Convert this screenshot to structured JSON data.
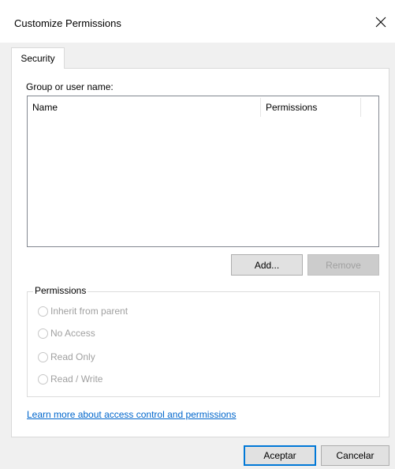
{
  "window": {
    "title": "Customize Permissions"
  },
  "tabs": [
    {
      "label": "Security",
      "selected": true
    }
  ],
  "security": {
    "group_label": "Group or user name:",
    "columns": [
      "Name",
      "Permissions"
    ],
    "rows": [],
    "add_label": "Add...",
    "remove_label": "Remove",
    "remove_enabled": false,
    "permissions_legend": "Permissions",
    "permission_options": [
      {
        "label": "Inherit from parent",
        "selected": false,
        "enabled": false
      },
      {
        "label": "No Access",
        "selected": false,
        "enabled": false
      },
      {
        "label": "Read Only",
        "selected": false,
        "enabled": false
      },
      {
        "label": "Read / Write",
        "selected": false,
        "enabled": false
      }
    ],
    "learn_more_link": "Learn more about access control and permissions"
  },
  "footer": {
    "ok_label": "Aceptar",
    "cancel_label": "Cancelar"
  },
  "icons": {
    "close": "close-icon"
  },
  "colors": {
    "accent": "#0078d7",
    "link": "#0066cc",
    "disabled_text": "#a0a0a0"
  }
}
